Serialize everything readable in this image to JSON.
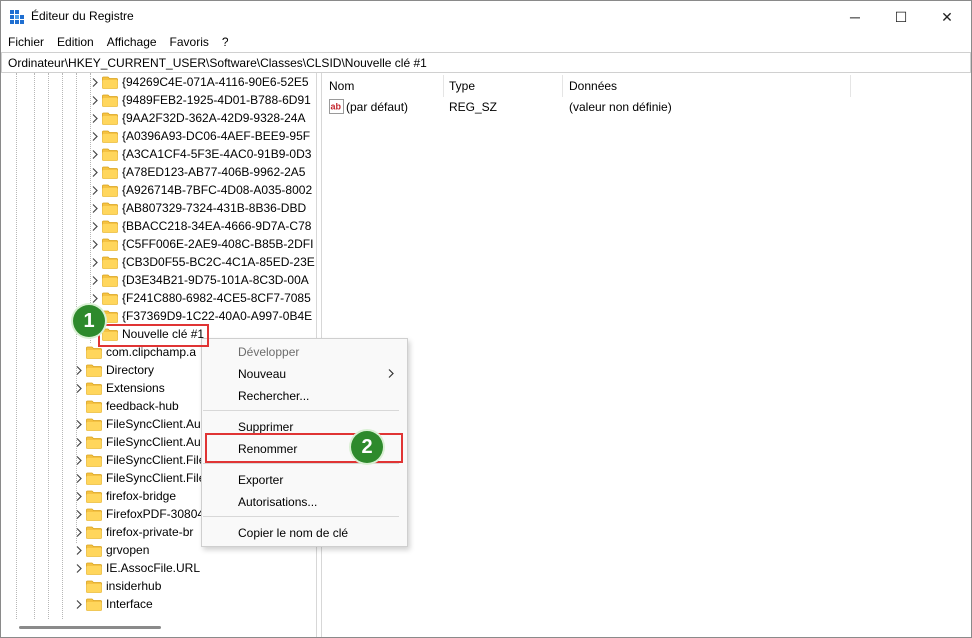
{
  "window": {
    "title": "Éditeur du Registre",
    "minimize_glyph": "─",
    "maximize_glyph": "☐",
    "close_glyph": "✕"
  },
  "menu": [
    "Fichier",
    "Edition",
    "Affichage",
    "Favoris",
    "?"
  ],
  "address": "Ordinateur\\HKEY_CURRENT_USER\\Software\\Classes\\CLSID\\Nouvelle clé #1",
  "tree": {
    "clsid_children": [
      "{94269C4E-071A-4116-90E6-52E5",
      "{9489FEB2-1925-4D01-B788-6D91",
      "{9AA2F32D-362A-42D9-9328-24A",
      "{A0396A93-DC06-4AEF-BEE9-95F",
      "{A3CA1CF4-5F3E-4AC0-91B9-0D3",
      "{A78ED123-AB77-406B-9962-2A5",
      "{A926714B-7BFC-4D08-A035-8002",
      "{AB807329-7324-431B-8B36-DBD",
      "{BBACC218-34EA-4666-9D7A-C78",
      "{C5FF006E-2AE9-408C-B85B-2DFI",
      "{CB3D0F55-BC2C-4C1A-85ED-23E",
      "{D3E34B21-9D75-101A-8C3D-00A",
      "{F241C880-6982-4CE5-8CF7-7085",
      "{F37369D9-1C22-40A0-A997-0B4E"
    ],
    "new_key": "Nouvelle clé #1",
    "classes_children": [
      "com.clipchamp.a",
      "Directory",
      "Extensions",
      "feedback-hub",
      "FileSyncClient.Au",
      "FileSyncClient.Au",
      "FileSyncClient.File",
      "FileSyncClient.File",
      "firefox-bridge",
      "FirefoxPDF-30804",
      "firefox-private-br",
      "grvopen",
      "IE.AssocFile.URL",
      "insiderhub",
      "Interface"
    ]
  },
  "list": {
    "columns": [
      "Nom",
      "Type",
      "Données"
    ],
    "rows": [
      {
        "name": "(par défaut)",
        "type": "REG_SZ",
        "data": "(valeur non définie)"
      }
    ]
  },
  "context_menu": {
    "develop": "Développer",
    "new": "Nouveau",
    "search": "Rechercher...",
    "delete": "Supprimer",
    "rename": "Renommer",
    "export": "Exporter",
    "permissions": "Autorisations...",
    "copy_key_name": "Copier le nom de clé"
  },
  "annotations": {
    "badge1": "1",
    "badge2": "2",
    "color": "#e03434",
    "badge_color": "#2e8a2c"
  }
}
